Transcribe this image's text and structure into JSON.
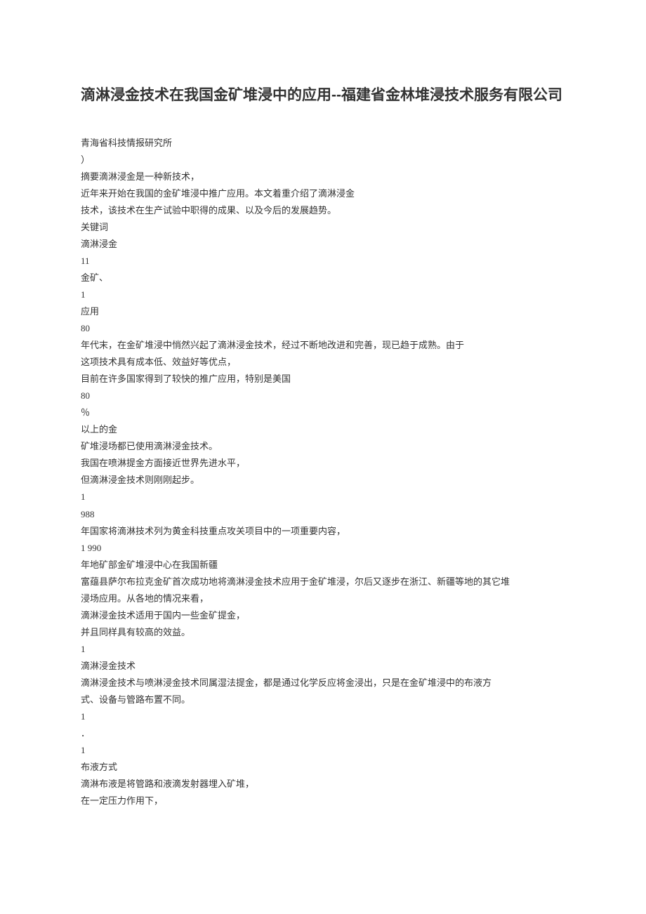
{
  "title": "滴淋浸金技术在我国金矿堆浸中的应用--福建省金林堆浸技术服务有限公司",
  "lines": [
    "青海省科技情报研究所",
    "）",
    "摘要滴淋浸金是一种新技术，",
    "近年来开始在我国的金矿堆浸中推广应用。本文着重介绍了滴淋浸金",
    "技术，该技术在生产试验中职得的成果、以及今后的发展趋势。",
    "关键词",
    "滴淋浸金",
    "11",
    "金矿、",
    "1",
    "应用",
    "80",
    "年代末，在金矿堆浸中悄然兴起了滴淋浸金技术，经过不断地改进和完善，现已趋于成熟。由于",
    "这项技术具有成本低、效益好等优点，",
    "目前在许多国家得到了较快的推广应用，特别是美国",
    "80",
    "％",
    "以上的金",
    "矿堆浸场都已使用滴淋浸金技术。",
    "我国在喷淋提金方面接近世界先进水平，",
    "但滴淋浸金技术则刚刚起步。",
    "1",
    "988",
    "年国家将滴淋技术列为黄金科技重点攻关项目中的一项重要内容，",
    "1 990",
    "年地矿部金矿堆浸中心在我国新疆",
    "富蕴县萨尔布拉克金矿首次成功地将滴淋浸金技术应用于金矿堆浸，尔后又逐步在浙江、新疆等地的其它堆",
    "浸场应用。从各地的情况来看，",
    "滴淋浸金技术适用于国内一些金矿提金，",
    "并且同样具有较高的效益。",
    "1",
    "滴淋浸金技术",
    "滴淋浸金技术与喷淋浸金技术同属湿法提金，都是通过化学反应将金浸出，只是在金矿堆浸中的布液方",
    "式、设备与管路布置不同。",
    "1",
    "．",
    "1",
    "布液方式",
    "滴淋布液是将管路和液滴发射器埋入矿堆，",
    "在一定压力作用下，"
  ]
}
